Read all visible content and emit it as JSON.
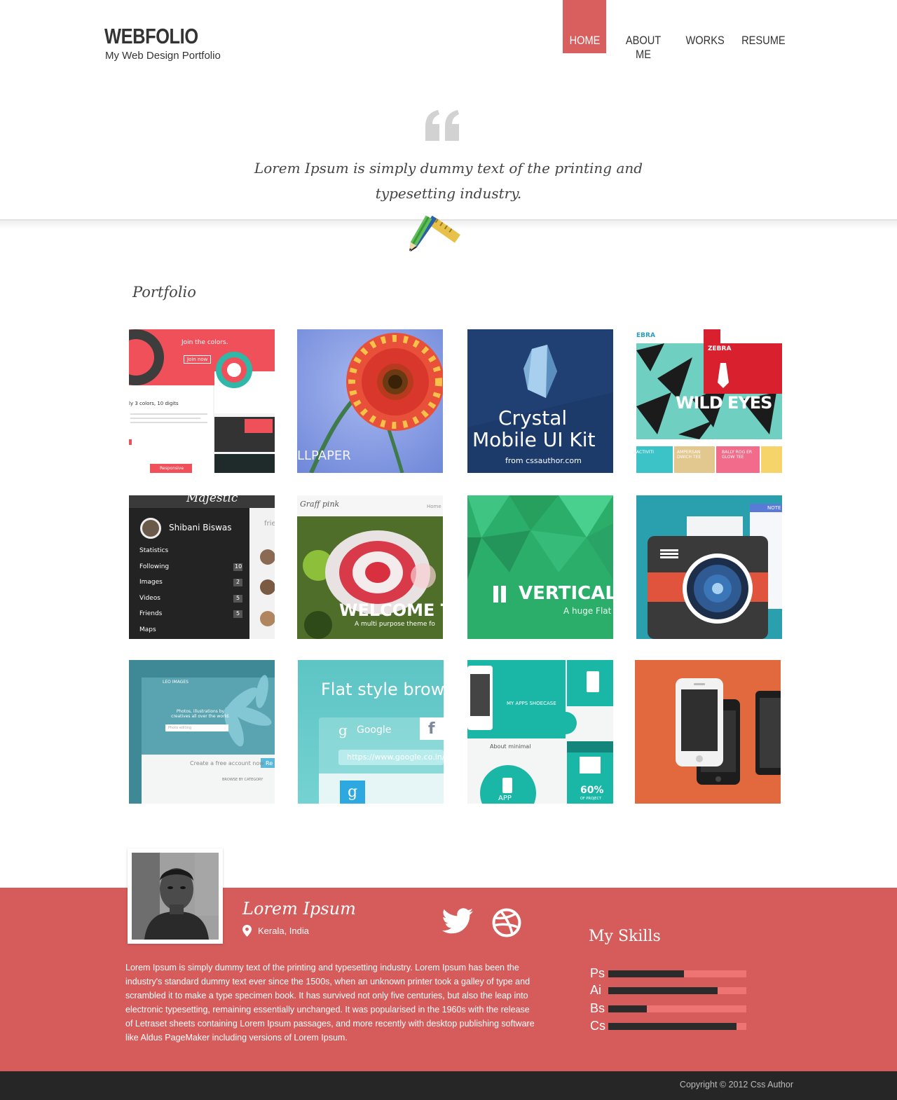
{
  "header": {
    "logo": "WEBFOLIO",
    "tagline": "My Web Design Portfolio",
    "nav": [
      {
        "label": "HOME",
        "active": true
      },
      {
        "label": "ABOUT ME",
        "active": false
      },
      {
        "label": "WORKS",
        "active": false
      },
      {
        "label": "RESUME",
        "active": false
      }
    ]
  },
  "hero": {
    "quote": "Lorem Ipsum is simply dummy text of the printing and typesetting industry."
  },
  "portfolio": {
    "title": "Portfolio",
    "items": [
      {
        "text": [
          "Join the colors.",
          "Join now",
          "ly 3 colors, 10 digits",
          "Responsive"
        ]
      },
      {
        "text": [
          "LLPAPER"
        ]
      },
      {
        "text": [
          "Crystal",
          "Mobile UI Kit",
          "from cssauthor.com"
        ]
      },
      {
        "text": [
          "EBRA",
          "ZEBRA",
          "WILD EYES",
          "AMPERSAN DWICH TEE",
          "BALLY ROG ER GLOW TEE",
          "ACTIVITI"
        ]
      },
      {
        "text": [
          "Majestic",
          "Shibani Biswas",
          "Statistics",
          "Following",
          "Images",
          "Videos",
          "Friends",
          "Maps",
          "10",
          "2",
          "5",
          "5",
          "frie"
        ]
      },
      {
        "text": [
          "Graff pink",
          "Home",
          "WELCOME T",
          "A multi purpose theme fo"
        ]
      },
      {
        "text": [
          "VERTICAL",
          "A huge Flat"
        ]
      },
      {
        "text": [
          "NOTE"
        ]
      },
      {
        "text": [
          "LEO IMAGES",
          "Photos, illustrations by creatives all over the world.",
          "Photo editing",
          "Create a free account now",
          "Re",
          "BROWSE BY CATEGORY"
        ]
      },
      {
        "text": [
          "Flat style browse",
          "Google",
          "https://www.google.co.in/se"
        ]
      },
      {
        "text": [
          "MY APPS SHOECASE",
          "About minimal",
          "APP",
          "60%",
          "OF PROJECT"
        ]
      },
      {
        "text": []
      }
    ]
  },
  "about": {
    "name": "Lorem Ipsum",
    "location": "Kerala, India",
    "bio": "Lorem Ipsum is simply dummy text of the printing and typesetting industry. Lorem Ipsum has been the industry's standard dummy text ever since the 1500s, when an unknown printer took a galley of type and scrambled it to make a type specimen book. It has survived not only five centuries, but also the leap into electronic typesetting, remaining essentially unchanged. It was popularised in the 1960s with the release of Letraset sheets containing Lorem Ipsum passages, and more recently with desktop publishing software like Aldus PageMaker including versions of Lorem Ipsum.",
    "social": [
      {
        "icon": "twitter-icon"
      },
      {
        "icon": "dribbble-icon"
      }
    ],
    "skills_title": "My Skills",
    "skills": [
      {
        "label": "Ps",
        "level": 0.55
      },
      {
        "label": "Ai",
        "level": 0.79
      },
      {
        "label": "Bs",
        "level": 0.28
      },
      {
        "label": "Cs",
        "level": 0.93
      }
    ]
  },
  "footer": {
    "copyright": "Copyright © 2012 Css Author"
  },
  "colors": {
    "accent": "#d95e5e",
    "footer_dark": "#262626"
  }
}
